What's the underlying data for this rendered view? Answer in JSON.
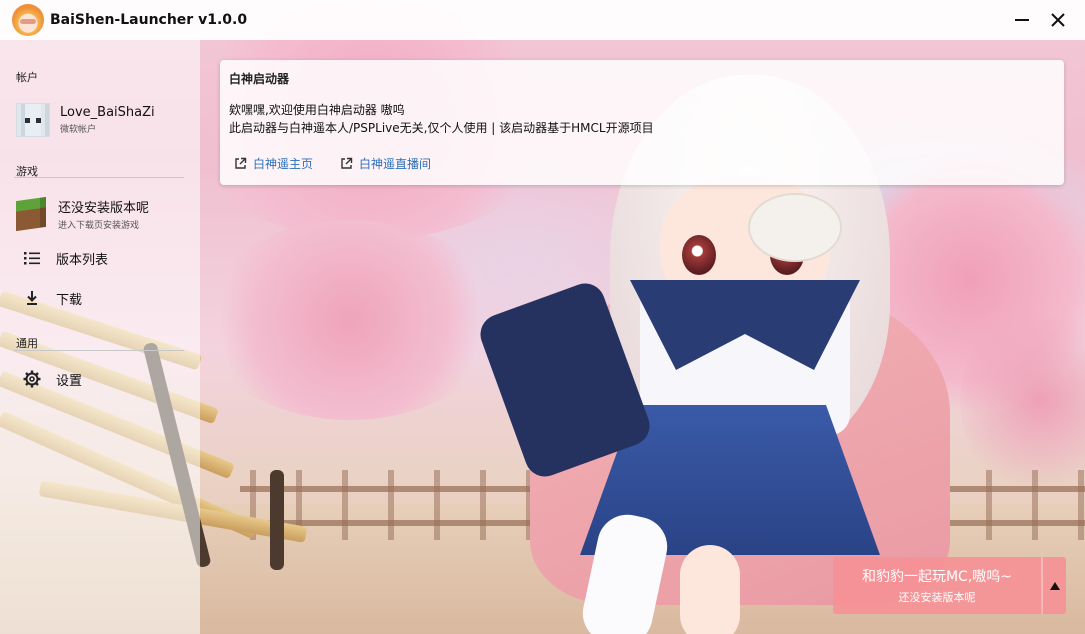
{
  "window": {
    "title": "BaiShen-Launcher v1.0.0",
    "minimize_icon": "minimize-icon",
    "close_icon": "close-icon"
  },
  "sidebar": {
    "account_section": "帐户",
    "account": {
      "name": "Love_BaiShaZi",
      "type": "微软帐户"
    },
    "game_section": "游戏",
    "game": {
      "title": "还没安装版本呢",
      "subtitle": "进入下载页安装游戏"
    },
    "items": [
      {
        "label": "版本列表",
        "icon": "list-icon"
      },
      {
        "label": "下载",
        "icon": "download-icon"
      }
    ],
    "general_section": "通用",
    "settings": {
      "label": "设置",
      "icon": "gear-icon"
    }
  },
  "announcement": {
    "title": "白神启动器",
    "line1": "欸嘿嘿,欢迎使用白神启动器 嗷呜",
    "line2": "此启动器与白神遥本人/PSPLive无关,仅个人使用 | 该启动器基于HMCL开源项目",
    "links": [
      {
        "label": "白神遥主页",
        "icon": "external-link-icon"
      },
      {
        "label": "白神遥直播间",
        "icon": "external-link-icon"
      }
    ]
  },
  "launch": {
    "line1": "和豹豹一起玩MC,嗷呜~",
    "line2": "还没安装版本呢",
    "more_icon": "triangle-up-icon"
  },
  "colors": {
    "accent_pink": "#f59196",
    "link_blue": "#2d6fb8"
  }
}
